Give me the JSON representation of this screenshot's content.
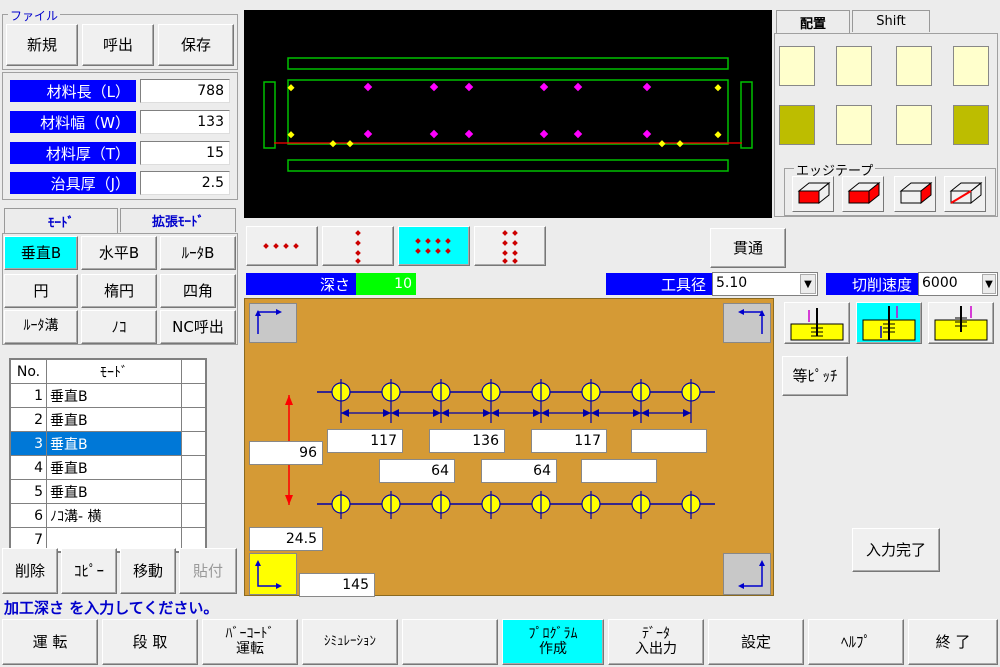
{
  "file_group": {
    "title": "ファイル",
    "new": "新規",
    "open": "呼出",
    "save": "保存"
  },
  "params": [
    {
      "label": "材料長（L）",
      "value": "788"
    },
    {
      "label": "材料幅（W）",
      "value": "133"
    },
    {
      "label": "材料厚（T）",
      "value": "15"
    },
    {
      "label": "治具厚（J）",
      "value": "2.5"
    }
  ],
  "mode_tabs": {
    "mode": "ﾓｰﾄﾞ",
    "ext": "拡張ﾓｰﾄﾞ"
  },
  "mode_buttons": [
    "垂直B",
    "水平B",
    "ﾙｰﾀB",
    "円",
    "楕円",
    "四角",
    "ﾙｰﾀ溝",
    "ﾉｺ",
    "NC呼出"
  ],
  "table": {
    "headers": [
      "No.",
      "ﾓｰﾄﾞ"
    ],
    "rows": [
      {
        "no": "1",
        "mode": "垂直B"
      },
      {
        "no": "2",
        "mode": "垂直B"
      },
      {
        "no": "3",
        "mode": "垂直B"
      },
      {
        "no": "4",
        "mode": "垂直B"
      },
      {
        "no": "5",
        "mode": "垂直B"
      },
      {
        "no": "6",
        "mode": "ﾉｺ溝- 横"
      },
      {
        "no": "7",
        "mode": ""
      }
    ],
    "selected_no": "3"
  },
  "edit_buttons": {
    "delete": "削除",
    "copy": "ｺﾋﾟｰ",
    "move": "移動",
    "paste": "貼付"
  },
  "status_message": "加工深さ を入力してください。",
  "bottom_buttons": [
    "運 転",
    "段 取",
    "ﾊﾞｰｺｰﾄﾞ\n運転",
    "ｼﾐｭﾚｰｼｮﾝ",
    "",
    "ﾌﾟﾛｸﾞﾗﾑ\n作成",
    "ﾃﾞｰﾀ\n入出力",
    "設定",
    "ﾍﾙﾌﾟ",
    "終 了"
  ],
  "layout_tabs": {
    "placement": "配置",
    "shift": "Shift"
  },
  "edge_tape_label": "エッジテープ",
  "through_button": "貫通",
  "depth": {
    "label": "深さ",
    "value": "10"
  },
  "tool_diameter": {
    "label": "工具径",
    "value": "5.10"
  },
  "cutting_speed": {
    "label": "切削速度",
    "value": "6000"
  },
  "equal_pitch_button": "等ﾋﾟｯﾁ",
  "input_done_button": "入力完了",
  "dimensions": {
    "top_pitches": [
      "117",
      "136",
      "117",
      ""
    ],
    "bottom_pitches": [
      "64",
      "64",
      ""
    ],
    "row_distance": "96",
    "offset_y": "24.5",
    "offset_x": "145"
  },
  "colors": {
    "accent_blue": "#0000ff",
    "active_cyan": "#00ffff",
    "panel_brown": "#d59a35",
    "hole_yellow": "#ffff00",
    "select_blue": "#0078d7"
  }
}
